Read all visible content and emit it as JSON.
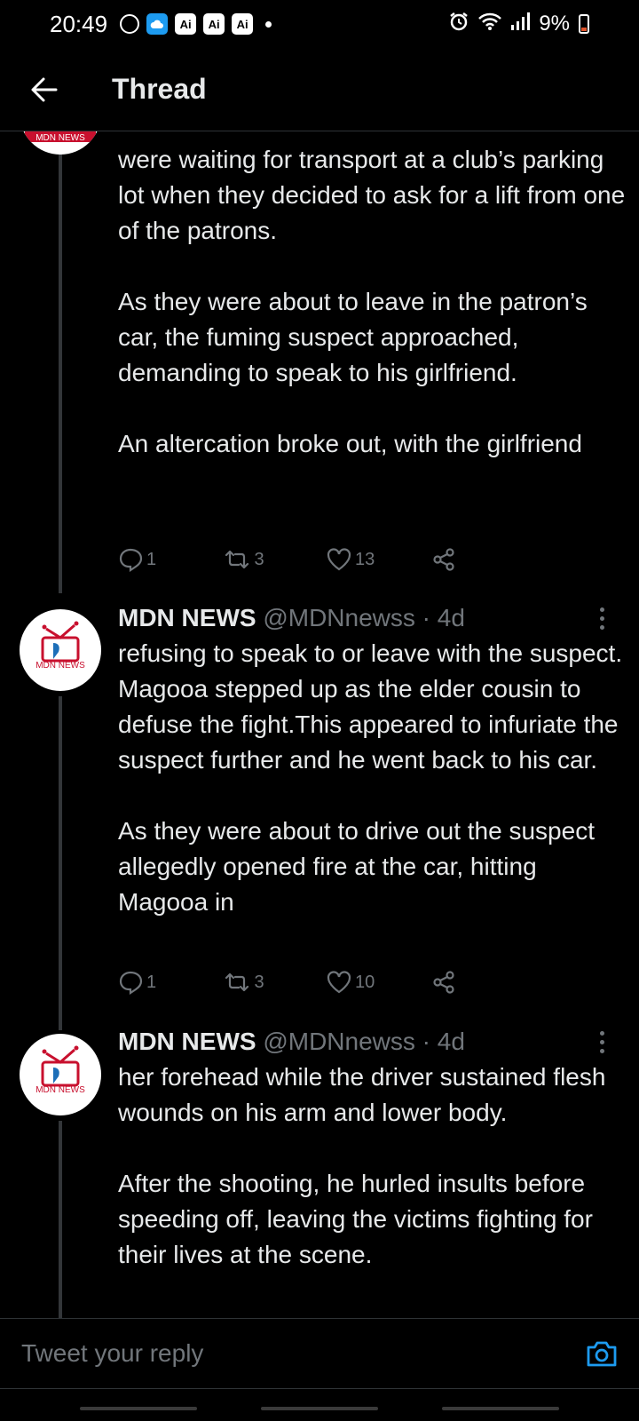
{
  "status_bar": {
    "time": "20:49",
    "ai_badge": "Ai",
    "battery": "9%"
  },
  "header": {
    "title": "Thread"
  },
  "tweets": [
    {
      "text": "were waiting for transport at a club’s parking lot when they decided to ask for a lift from one of the patrons.\n\nAs they were about to leave in the patron’s car, the fuming suspect approached, demanding to speak to his girlfriend.\n\nAn altercation broke out, with the girlfriend",
      "replies": "1",
      "retweets": "3",
      "likes": "13"
    },
    {
      "name": "MDN NEWS",
      "handle": "@MDNnewss",
      "time": "· 4d",
      "text": "refusing to speak to or leave with the suspect. Magooa stepped up as the elder cousin to defuse the fight.This appeared to infuriate the suspect further and he went back to his car.\n\nAs they were about to drive out the suspect allegedly opened fire at the car, hitting Magooa in",
      "replies": "1",
      "retweets": "3",
      "likes": "10"
    },
    {
      "name": "MDN NEWS",
      "handle": "@MDNnewss",
      "time": "· 4d",
      "text": "her forehead while the driver sustained flesh wounds on his arm and lower body.\n\nAfter the shooting, he hurled insults before speeding off, leaving the victims fighting for their lives at the scene."
    }
  ],
  "avatar_logo_text": "MDN NEWS",
  "reply": {
    "placeholder": "Tweet your reply"
  },
  "colors": {
    "background": "#000000",
    "text": "#e7e9ea",
    "muted": "#71767b",
    "accent": "#1d9bf0",
    "logo_red": "#c8102e"
  }
}
